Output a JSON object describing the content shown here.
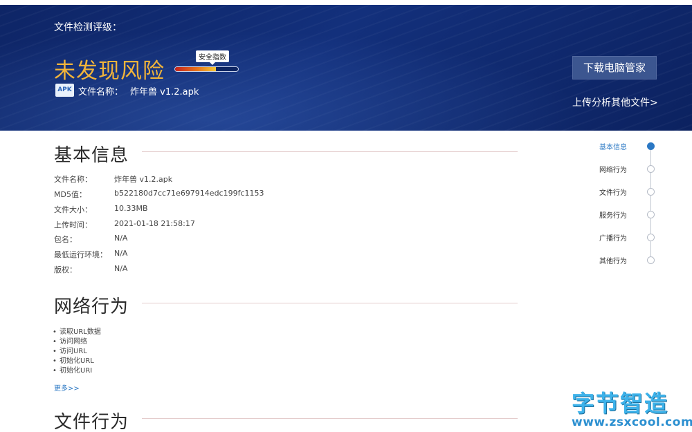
{
  "header": {
    "rating_label": "文件检测评级：",
    "risk_result": "未发现风险",
    "safety_index_label": "安全指数",
    "safety_index_level": 0.65,
    "apk_icon_text": "APK",
    "file_name_label": "文件名称：",
    "file_name_value": "炸年兽 v1.2.apk",
    "download_button": "下载电脑管家",
    "upload_link": "上传分析其他文件>"
  },
  "basic_info": {
    "title": "基本信息",
    "rows": [
      {
        "label": "文件名称：",
        "value": "炸年兽 v1.2.apk"
      },
      {
        "label": "MD5值：",
        "value": "b522180d7cc71e697914edc199fc1153"
      },
      {
        "label": "文件大小：",
        "value": "10.33MB"
      },
      {
        "label": "上传时间：",
        "value": "2021-01-18 21:58:17"
      },
      {
        "label": "包名：",
        "value": "N/A"
      },
      {
        "label": "最低运行环境：",
        "value": "N/A"
      },
      {
        "label": "版权：",
        "value": "N/A"
      }
    ]
  },
  "network": {
    "title": "网络行为",
    "items": [
      "读取URL数据",
      "访问网络",
      "访问URL",
      "初始化URL",
      "初始化URI"
    ],
    "more_link": "更多>>"
  },
  "file_behavior": {
    "title": "文件行为"
  },
  "side_nav": {
    "items": [
      {
        "label": "基本信息",
        "active": true
      },
      {
        "label": "网络行为",
        "active": false
      },
      {
        "label": "文件行为",
        "active": false
      },
      {
        "label": "服务行为",
        "active": false
      },
      {
        "label": "广播行为",
        "active": false
      },
      {
        "label": "其他行为",
        "active": false
      }
    ]
  },
  "watermark": {
    "name": "字节智造",
    "url": "www.zsxcool.com"
  },
  "colors": {
    "banner_bg": "#13307c",
    "risk_text": "#f2b43a",
    "accent_blue": "#2b78c4"
  }
}
